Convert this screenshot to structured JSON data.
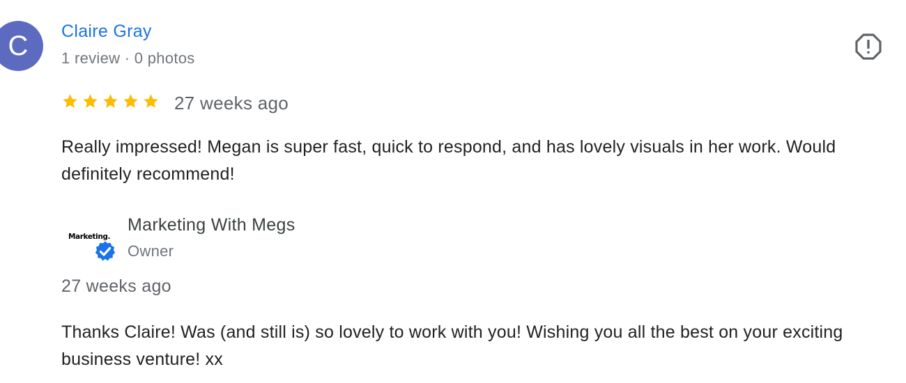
{
  "review": {
    "avatar_letter": "C",
    "avatar_color": "#5c6bc0",
    "reviewer_name": "Claire Gray",
    "reviewer_meta": "1 review · 0 photos",
    "rating": 5,
    "max_rating": 5,
    "star_color": "#fbbc04",
    "date": "27 weeks ago",
    "text": "Really impressed! Megan is super fast, quick to respond, and has lovely visuals in her work. Would definitely recommend!",
    "flag_icon": "report-flag-icon"
  },
  "owner_response": {
    "logo_text": "Marketing.",
    "badge_icon": "verified-check-icon",
    "badge_color": "#1a73e8",
    "name": "Marketing With Megs",
    "role": "Owner",
    "date": "27 weeks ago",
    "text": "Thanks Claire! Was (and still is) so lovely to work with you! Wishing you all the best on your exciting business venture! xx"
  }
}
